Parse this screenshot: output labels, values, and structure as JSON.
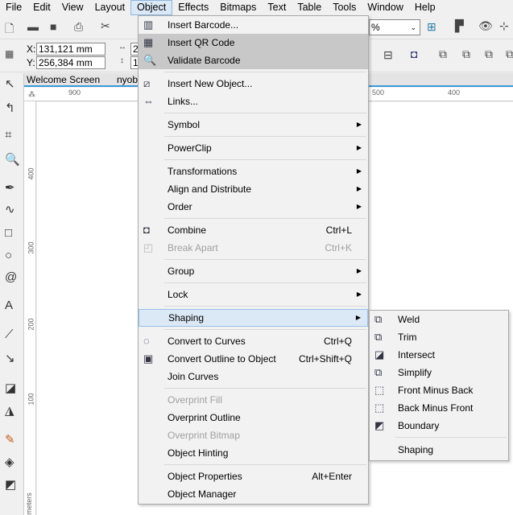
{
  "menubar": [
    "File",
    "Edit",
    "View",
    "Layout",
    "Object",
    "Effects",
    "Bitmaps",
    "Text",
    "Table",
    "Tools",
    "Window",
    "Help"
  ],
  "active_menu": "Object",
  "toolbar": {
    "zoom_suffix": "%"
  },
  "propbar": {
    "x_label": "X:",
    "x_value": "131,121 mm",
    "y_label": "Y:",
    "y_value": "256,384 mm",
    "w_value": "2",
    "h_value": "1"
  },
  "tabs": [
    "Welcome Screen",
    "nyob"
  ],
  "ruler": {
    "h": [
      "900",
      "500",
      "400"
    ],
    "v": [
      "400",
      "300",
      "200",
      "100"
    ],
    "unit": "meters"
  },
  "object_menu": [
    {
      "label": "Insert Barcode...",
      "icon": "barcode-icon",
      "state": "normal"
    },
    {
      "label": "Insert QR Code",
      "icon": "qr-code-icon",
      "state": "hover"
    },
    {
      "label": "Validate Barcode",
      "icon": "magnifier-icon",
      "state": "hover"
    },
    {
      "sep": true
    },
    {
      "label": "Insert New Object...",
      "icon": "insert-object-icon"
    },
    {
      "label": "Links...",
      "icon": "ole-icon"
    },
    {
      "sep": true
    },
    {
      "label": "Symbol",
      "submenu": true
    },
    {
      "sep": true
    },
    {
      "label": "PowerClip",
      "submenu": true
    },
    {
      "sep": true
    },
    {
      "label": "Transformations",
      "submenu": true
    },
    {
      "label": "Align and Distribute",
      "submenu": true
    },
    {
      "label": "Order",
      "submenu": true
    },
    {
      "sep": true
    },
    {
      "label": "Combine",
      "shortcut": "Ctrl+L",
      "icon": "combine-icon"
    },
    {
      "label": "Break Apart",
      "shortcut": "Ctrl+K",
      "icon": "break-apart-icon",
      "state": "disabled"
    },
    {
      "sep": true
    },
    {
      "label": "Group",
      "submenu": true
    },
    {
      "sep": true
    },
    {
      "label": "Lock",
      "submenu": true
    },
    {
      "sep": true
    },
    {
      "label": "Shaping",
      "submenu": true,
      "state": "selected"
    },
    {
      "sep": true
    },
    {
      "label": "Convert to Curves",
      "shortcut": "Ctrl+Q",
      "icon": "convert-curves-icon"
    },
    {
      "label": "Convert Outline to Object",
      "shortcut": "Ctrl+Shift+Q",
      "icon": "convert-outline-icon"
    },
    {
      "label": "Join Curves"
    },
    {
      "sep": true
    },
    {
      "label": "Overprint Fill",
      "state": "disabled"
    },
    {
      "label": "Overprint Outline"
    },
    {
      "label": "Overprint Bitmap",
      "state": "disabled"
    },
    {
      "label": "Object Hinting"
    },
    {
      "sep": true
    },
    {
      "label": "Object Properties",
      "shortcut": "Alt+Enter"
    },
    {
      "label": "Object Manager"
    }
  ],
  "shaping_submenu": [
    {
      "label": "Weld",
      "icon": "weld-icon"
    },
    {
      "label": "Trim",
      "icon": "trim-icon"
    },
    {
      "label": "Intersect",
      "icon": "intersect-icon"
    },
    {
      "label": "Simplify",
      "icon": "simplify-icon"
    },
    {
      "label": "Front Minus Back",
      "icon": "front-minus-back-icon"
    },
    {
      "label": "Back Minus Front",
      "icon": "back-minus-front-icon"
    },
    {
      "label": "Boundary",
      "icon": "boundary-icon"
    },
    {
      "sep": true
    },
    {
      "label": "Shaping"
    }
  ]
}
